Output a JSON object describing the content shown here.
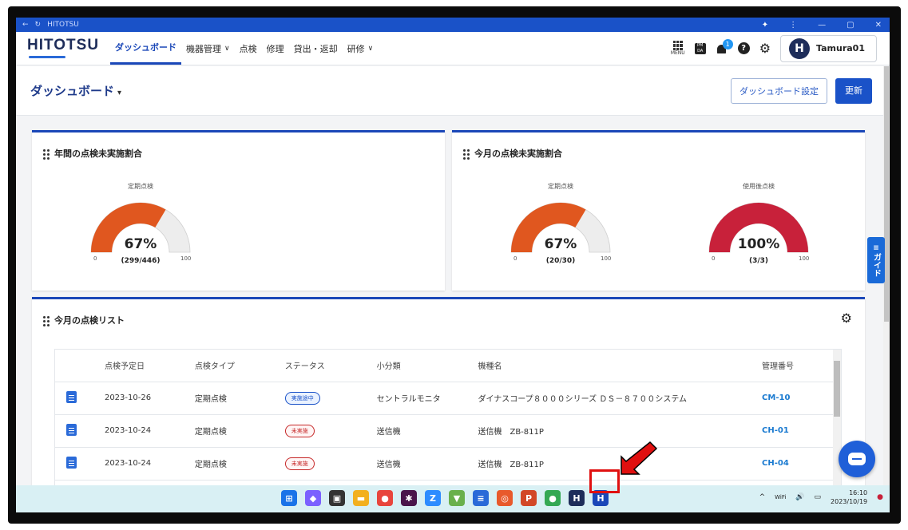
{
  "titlebar": {
    "app": "HITOTSU",
    "back": "←",
    "reload": "↻",
    "extension": "✦",
    "more": "⋮",
    "min": "—",
    "max": "▢",
    "close": "✕"
  },
  "nav": {
    "logo": "HITOTSU",
    "items": [
      {
        "label": "ダッシュボード",
        "chevron": ""
      },
      {
        "label": "機器管理",
        "chevron": "∨"
      },
      {
        "label": "点検",
        "chevron": ""
      },
      {
        "label": "修理",
        "chevron": ""
      },
      {
        "label": "貸出・返却",
        "chevron": ""
      },
      {
        "label": "研修",
        "chevron": "∨"
      }
    ],
    "menu_label": "MENU",
    "pmda_label": "PM DA",
    "notification_count": "1",
    "help": "?",
    "settings": "⚙",
    "avatar_letter": "H",
    "user_name": "Tamura01"
  },
  "header": {
    "title": "ダッシュボード",
    "caret": "▾",
    "settings_button": "ダッシュボード設定",
    "refresh_button": "更新"
  },
  "cards": {
    "annual": {
      "title": "年間の点検未実施割合",
      "gauges": [
        {
          "label": "定期点検",
          "percent": "67%",
          "fraction": "(299/446)",
          "value": 0.67,
          "min": "0",
          "max": "100",
          "color": "#e0571f"
        }
      ]
    },
    "monthly": {
      "title": "今月の点検未実施割合",
      "gauges": [
        {
          "label": "定期点検",
          "percent": "67%",
          "fraction": "(20/30)",
          "value": 0.67,
          "min": "0",
          "max": "100",
          "color": "#e0571f"
        },
        {
          "label": "使用後点検",
          "percent": "100%",
          "fraction": "(3/3)",
          "value": 1.0,
          "min": "0",
          "max": "100",
          "color": "#c8213a"
        }
      ]
    },
    "list": {
      "title": "今月の点検リスト",
      "columns": [
        "点検予定日",
        "点検タイプ",
        "ステータス",
        "小分類",
        "機種名",
        "管理番号"
      ],
      "rows": [
        {
          "date": "2023-10-26",
          "type": "定期点検",
          "status": "実施途中",
          "status_kind": "prog",
          "category": "セントラルモニタ",
          "model": "ダイナスコープ８０００シリーズ ＤＳ－８７００システム",
          "code": "CM-10"
        },
        {
          "date": "2023-10-24",
          "type": "定期点検",
          "status": "未実施",
          "status_kind": "not",
          "category": "送信機",
          "model": "送信機　ZB-811P",
          "code": "CH-01"
        },
        {
          "date": "2023-10-24",
          "type": "定期点検",
          "status": "未実施",
          "status_kind": "not",
          "category": "送信機",
          "model": "送信機　ZB-811P",
          "code": "CH-04"
        }
      ]
    }
  },
  "guide_tab": {
    "label": "ガイド"
  },
  "taskbar": {
    "apps": [
      {
        "name": "windows-start",
        "glyph": "⊞",
        "color": "#1a73e8"
      },
      {
        "name": "copilot",
        "glyph": "◆",
        "color": "#7b61ff"
      },
      {
        "name": "task-view",
        "glyph": "▣",
        "color": "#333"
      },
      {
        "name": "file-explorer",
        "glyph": "▬",
        "color": "#f2b01e"
      },
      {
        "name": "chrome-profile",
        "glyph": "●",
        "color": "#e8453c"
      },
      {
        "name": "slack",
        "glyph": "✱",
        "color": "#4a154b"
      },
      {
        "name": "zoom",
        "glyph": "Z",
        "color": "#2d8cff"
      },
      {
        "name": "app-green",
        "glyph": "▼",
        "color": "#6ab04c"
      },
      {
        "name": "notepad",
        "glyph": "≡",
        "color": "#2a6ad8"
      },
      {
        "name": "app-orange",
        "glyph": "◎",
        "color": "#e8592b"
      },
      {
        "name": "powerpoint",
        "glyph": "P",
        "color": "#d24726"
      },
      {
        "name": "chrome-hitotsu",
        "glyph": "●",
        "color": "#34a853"
      },
      {
        "name": "hitotsu-h",
        "glyph": "H",
        "color": "#1e2d5a"
      },
      {
        "name": "hitotsu-active",
        "glyph": "H",
        "color": "#1a47b8"
      }
    ],
    "tray_chevron": "^",
    "wifi": "WiFi",
    "volume": "🔊",
    "battery": "▭",
    "time": "16:10",
    "date": "2023/10/19"
  },
  "colors": {
    "accent": "#1a47b8",
    "alert": "#e01010"
  }
}
